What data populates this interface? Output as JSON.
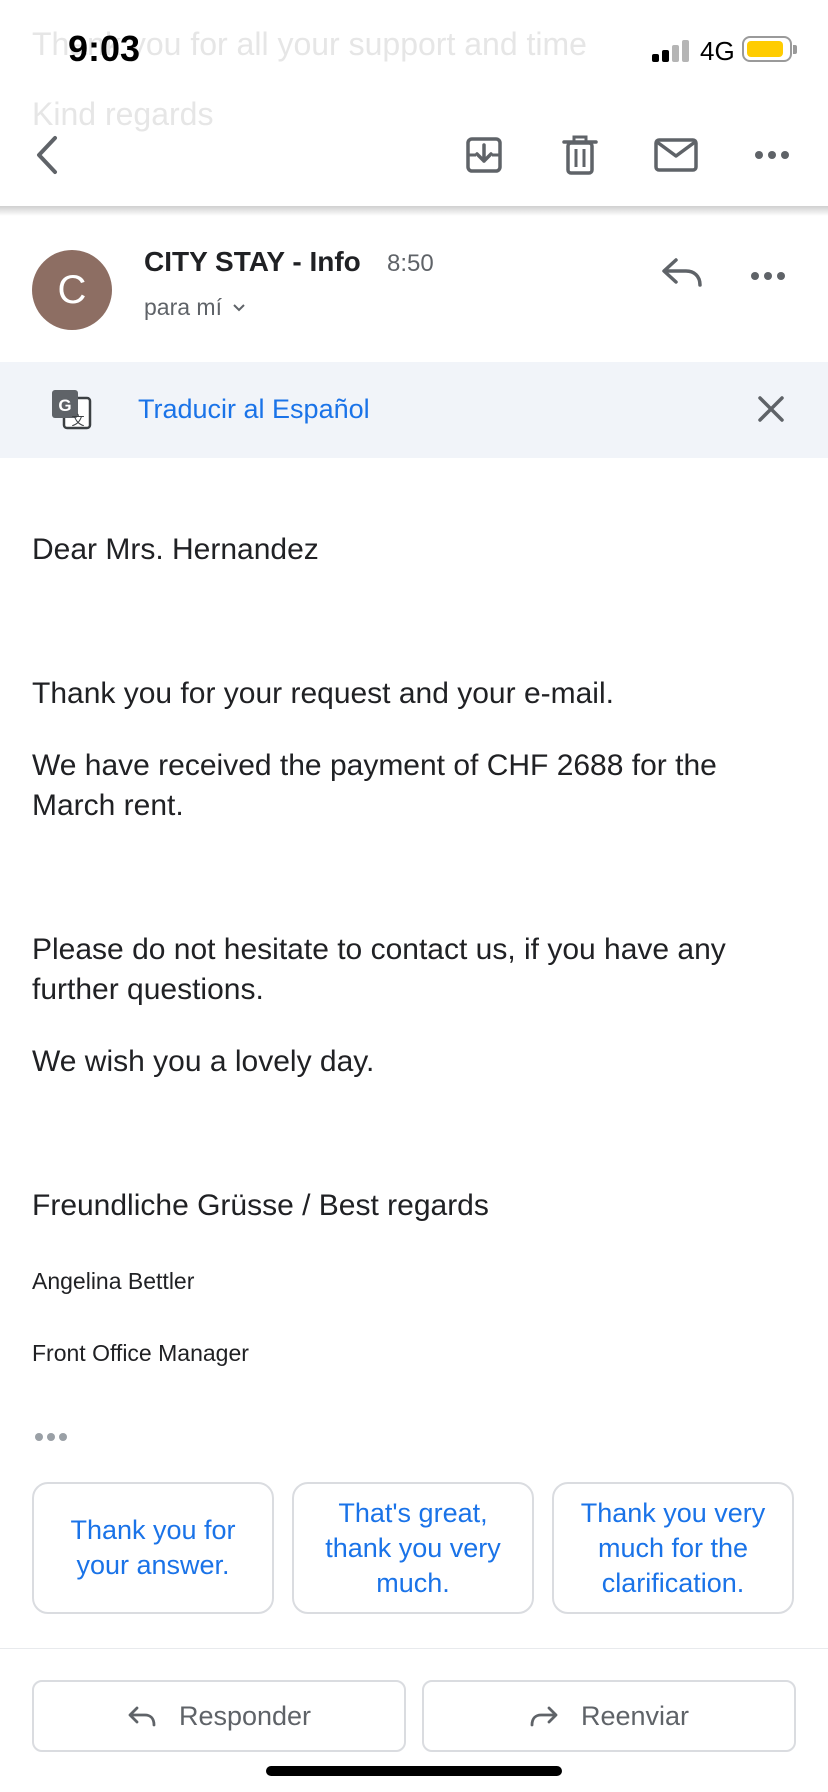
{
  "status_bar": {
    "time": "9:03",
    "network": "4G"
  },
  "background_faded": {
    "line1": "Thank you for all your support and time",
    "line2": "Kind regards"
  },
  "message": {
    "sender_initial": "C",
    "sender_name": "CITY STAY - Info",
    "time": "8:50",
    "recipient": "para mí"
  },
  "translate_bar": {
    "label": "Traducir al Español"
  },
  "email_body": {
    "greeting": "Dear Mrs. Hernandez",
    "p1": "Thank you for your request and your e-mail.",
    "p2": "We have received the payment of CHF 2688 for the March rent.",
    "p3": "Please do not hesitate to contact us, if you have any further questions.",
    "p4": "We wish you a lovely day.",
    "closing": "Freundliche Grüsse / Best regards",
    "signature_name": "Angelina Bettler",
    "signature_title": "Front Office Manager"
  },
  "smart_replies": [
    "Thank you for your answer.",
    "That's great, thank you very much.",
    "Thank you very much for the clarification."
  ],
  "actions": {
    "reply": "Responder",
    "forward": "Reenviar"
  },
  "colors": {
    "accent": "#1a73e8",
    "avatar": "#8d6e63",
    "battery": "#ffcc00",
    "banner": "#f1f4f9"
  }
}
